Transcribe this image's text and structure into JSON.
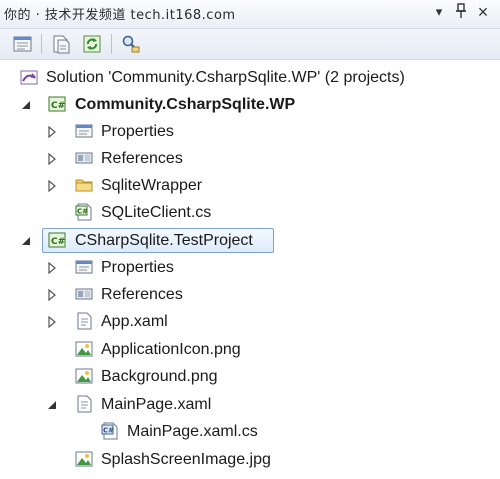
{
  "titlebar": {
    "title": "你的 · 技术开发频道 tech.it168.com",
    "pin_glyph": "▾",
    "autohide_glyph": "ꟸ",
    "close_glyph": "×"
  },
  "tree": {
    "solution": {
      "label": "Solution 'Community.CsharpSqlite.WP' (2 projects)"
    },
    "project1": {
      "label": "Community.CsharpSqlite.WP",
      "items": [
        {
          "label": "Properties"
        },
        {
          "label": "References"
        },
        {
          "label": "SqliteWrapper"
        },
        {
          "label": "SQLiteClient.cs"
        }
      ]
    },
    "project2": {
      "label": "CSharpSqlite.TestProject",
      "items": [
        {
          "label": "Properties"
        },
        {
          "label": "References"
        },
        {
          "label": "App.xaml"
        },
        {
          "label": "ApplicationIcon.png"
        },
        {
          "label": "Background.png"
        },
        {
          "label": "MainPage.xaml"
        },
        {
          "label": "MainPage.xaml.cs"
        },
        {
          "label": "SplashScreenImage.jpg"
        }
      ]
    }
  },
  "colors": {
    "selection_border": "#7da2ce",
    "tree_text": "#1a1a1a",
    "titlebar_bg": "#e9eef6"
  }
}
